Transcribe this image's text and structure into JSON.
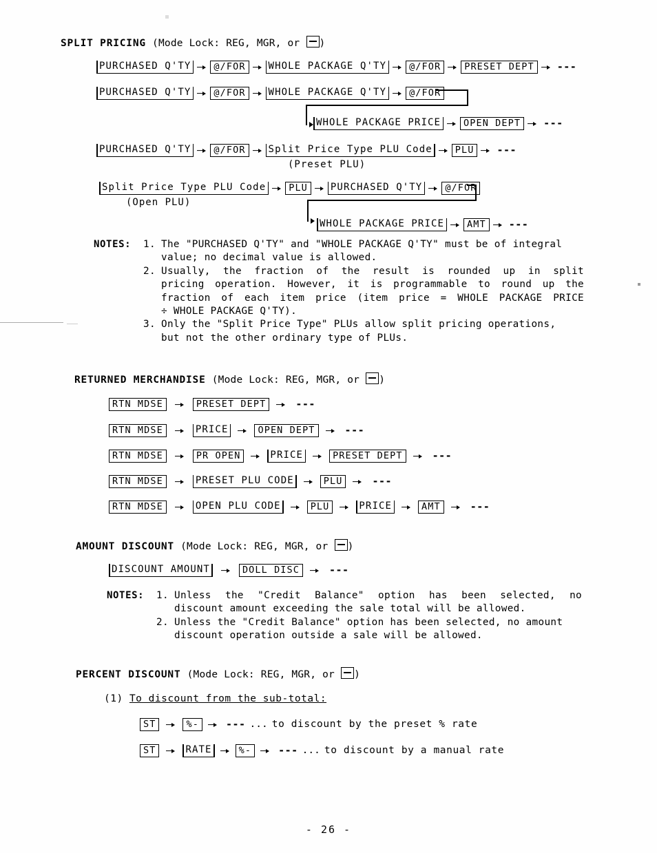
{
  "page": {
    "footer": "- 26 -"
  },
  "mode_lock_suffix": ")",
  "sections": [
    {
      "id": "split-pricing",
      "title": "SPLIT PRICING",
      "mode": "(Mode Lock: REG, MGR, or",
      "flows": [
        {
          "tokens": [
            {
              "type": "entry",
              "label": "PURCHASED Q'TY"
            },
            {
              "type": "arrow"
            },
            {
              "type": "key",
              "label": "@/FOR"
            },
            {
              "type": "arrow"
            },
            {
              "type": "entry",
              "label": "WHOLE PACKAGE Q'TY"
            },
            {
              "type": "arrow"
            },
            {
              "type": "key",
              "label": "@/FOR"
            },
            {
              "type": "arrow"
            },
            {
              "type": "key",
              "label": "PRESET DEPT"
            },
            {
              "type": "arrow"
            },
            {
              "type": "dashes",
              "label": "---"
            }
          ]
        },
        {
          "tokens": [
            {
              "type": "entry",
              "label": "PURCHASED Q'TY"
            },
            {
              "type": "arrow"
            },
            {
              "type": "key",
              "label": "@/FOR"
            },
            {
              "type": "arrow"
            },
            {
              "type": "entry",
              "label": "WHOLE PACKAGE Q'TY"
            },
            {
              "type": "arrow"
            },
            {
              "type": "key",
              "label": "@/FOR"
            }
          ]
        },
        {
          "tokens": [
            {
              "type": "entry",
              "label": "WHOLE PACKAGE PRICE"
            },
            {
              "type": "arrow"
            },
            {
              "type": "key",
              "label": "OPEN DEPT"
            },
            {
              "type": "arrow"
            },
            {
              "type": "dashes",
              "label": "---"
            }
          ]
        },
        {
          "tokens": [
            {
              "type": "entry",
              "label": "PURCHASED Q'TY"
            },
            {
              "type": "arrow"
            },
            {
              "type": "key",
              "label": "@/FOR"
            },
            {
              "type": "arrow"
            },
            {
              "type": "entry",
              "label": "Split Price Type PLU Code"
            },
            {
              "type": "arrow"
            },
            {
              "type": "key",
              "label": "PLU"
            },
            {
              "type": "arrow"
            },
            {
              "type": "dashes",
              "label": "---"
            }
          ],
          "sublabel": "(Preset PLU)"
        },
        {
          "tokens": [
            {
              "type": "entry",
              "label": "Split Price Type PLU Code"
            },
            {
              "type": "arrow"
            },
            {
              "type": "key",
              "label": "PLU"
            },
            {
              "type": "arrow"
            },
            {
              "type": "entry",
              "label": "PURCHASED Q'TY"
            },
            {
              "type": "arrow"
            },
            {
              "type": "key",
              "label": "@/FOR"
            }
          ],
          "sublabel": "(Open PLU)"
        },
        {
          "tokens": [
            {
              "type": "entry",
              "label": "WHOLE PACKAGE PRICE"
            },
            {
              "type": "arrow"
            },
            {
              "type": "key",
              "label": "AMT"
            },
            {
              "type": "arrow"
            },
            {
              "type": "dashes",
              "label": "---"
            }
          ]
        }
      ],
      "notes_label": "NOTES:",
      "notes": [
        {
          "num": "1.",
          "lines": [
            "The \"PURCHASED Q'TY\" and \"WHOLE PACKAGE Q'TY\" must be of integral",
            "value; no decimal value is allowed."
          ]
        },
        {
          "num": "2.",
          "lines": [
            "Usually, the fraction of the result is rounded up in split",
            "pricing operation.  However, it is programmable to round up the",
            "fraction of each item price (item price = WHOLE PACKAGE PRICE",
            "÷ WHOLE PACKAGE Q'TY)."
          ]
        },
        {
          "num": "3.",
          "lines": [
            "Only the \"Split Price Type\" PLUs allow split pricing operations,",
            "but not the other ordinary type of PLUs."
          ]
        }
      ]
    },
    {
      "id": "returned-merchandise",
      "title": "RETURNED MERCHANDISE",
      "mode": "(Mode Lock: REG, MGR, or",
      "flows": [
        {
          "tokens": [
            {
              "type": "key",
              "label": "RTN MDSE"
            },
            {
              "type": "arrow"
            },
            {
              "type": "key",
              "label": "PRESET DEPT"
            },
            {
              "type": "arrow"
            },
            {
              "type": "dashes",
              "label": "---"
            }
          ]
        },
        {
          "tokens": [
            {
              "type": "key",
              "label": "RTN MDSE"
            },
            {
              "type": "arrow"
            },
            {
              "type": "entry",
              "label": "PRICE"
            },
            {
              "type": "arrow"
            },
            {
              "type": "key",
              "label": "OPEN DEPT"
            },
            {
              "type": "arrow"
            },
            {
              "type": "dashes",
              "label": "---"
            }
          ]
        },
        {
          "tokens": [
            {
              "type": "key",
              "label": "RTN MDSE"
            },
            {
              "type": "arrow"
            },
            {
              "type": "key",
              "label": "PR OPEN"
            },
            {
              "type": "arrow"
            },
            {
              "type": "entry",
              "label": "PRICE"
            },
            {
              "type": "arrow"
            },
            {
              "type": "key",
              "label": "PRESET DEPT"
            },
            {
              "type": "arrow"
            },
            {
              "type": "dashes",
              "label": "---"
            }
          ]
        },
        {
          "tokens": [
            {
              "type": "key",
              "label": "RTN MDSE"
            },
            {
              "type": "arrow"
            },
            {
              "type": "entry",
              "label": "PRESET PLU CODE"
            },
            {
              "type": "arrow"
            },
            {
              "type": "key",
              "label": "PLU"
            },
            {
              "type": "arrow"
            },
            {
              "type": "dashes",
              "label": "---"
            }
          ]
        },
        {
          "tokens": [
            {
              "type": "key",
              "label": "RTN MDSE"
            },
            {
              "type": "arrow"
            },
            {
              "type": "entry",
              "label": "OPEN PLU CODE"
            },
            {
              "type": "arrow"
            },
            {
              "type": "key",
              "label": "PLU"
            },
            {
              "type": "arrow"
            },
            {
              "type": "entry",
              "label": "PRICE"
            },
            {
              "type": "arrow"
            },
            {
              "type": "key",
              "label": "AMT"
            },
            {
              "type": "arrow"
            },
            {
              "type": "dashes",
              "label": "---"
            }
          ]
        }
      ]
    },
    {
      "id": "amount-discount",
      "title": "AMOUNT DISCOUNT",
      "mode": "(Mode Lock: REG, MGR, or",
      "flows": [
        {
          "tokens": [
            {
              "type": "entry",
              "label": "DISCOUNT AMOUNT"
            },
            {
              "type": "arrow"
            },
            {
              "type": "key",
              "label": "DOLL DISC"
            },
            {
              "type": "arrow"
            },
            {
              "type": "dashes",
              "label": "---"
            }
          ]
        }
      ],
      "notes_label": "NOTES:",
      "notes": [
        {
          "num": "1.",
          "lines": [
            "Unless the \"Credit Balance\" option has been selected, no",
            "discount amount exceeding the sale total will be allowed."
          ]
        },
        {
          "num": "2.",
          "lines": [
            "Unless the \"Credit Balance\" option has been selected, no amount",
            "discount operation outside a sale will be allowed."
          ]
        }
      ]
    },
    {
      "id": "percent-discount",
      "title": "PERCENT DISCOUNT",
      "mode": "(Mode Lock: REG, MGR, or",
      "subheading_num": "(1)",
      "subheading_text": "To discount from the sub-total:",
      "flows": [
        {
          "tokens": [
            {
              "type": "key",
              "label": "ST"
            },
            {
              "type": "arrow"
            },
            {
              "type": "key",
              "label": "%-"
            },
            {
              "type": "arrow"
            },
            {
              "type": "dashes",
              "label": "---"
            },
            {
              "type": "ellipsis",
              "label": "..."
            },
            {
              "type": "tail",
              "label": "to discount by the preset % rate"
            }
          ]
        },
        {
          "tokens": [
            {
              "type": "key",
              "label": "ST"
            },
            {
              "type": "arrow"
            },
            {
              "type": "entry",
              "label": "RATE"
            },
            {
              "type": "arrow"
            },
            {
              "type": "key",
              "label": "%-"
            },
            {
              "type": "arrow"
            },
            {
              "type": "dashes",
              "label": "---"
            },
            {
              "type": "ellipsis",
              "label": "..."
            },
            {
              "type": "tail",
              "label": "to discount by a manual rate"
            }
          ]
        }
      ]
    }
  ]
}
